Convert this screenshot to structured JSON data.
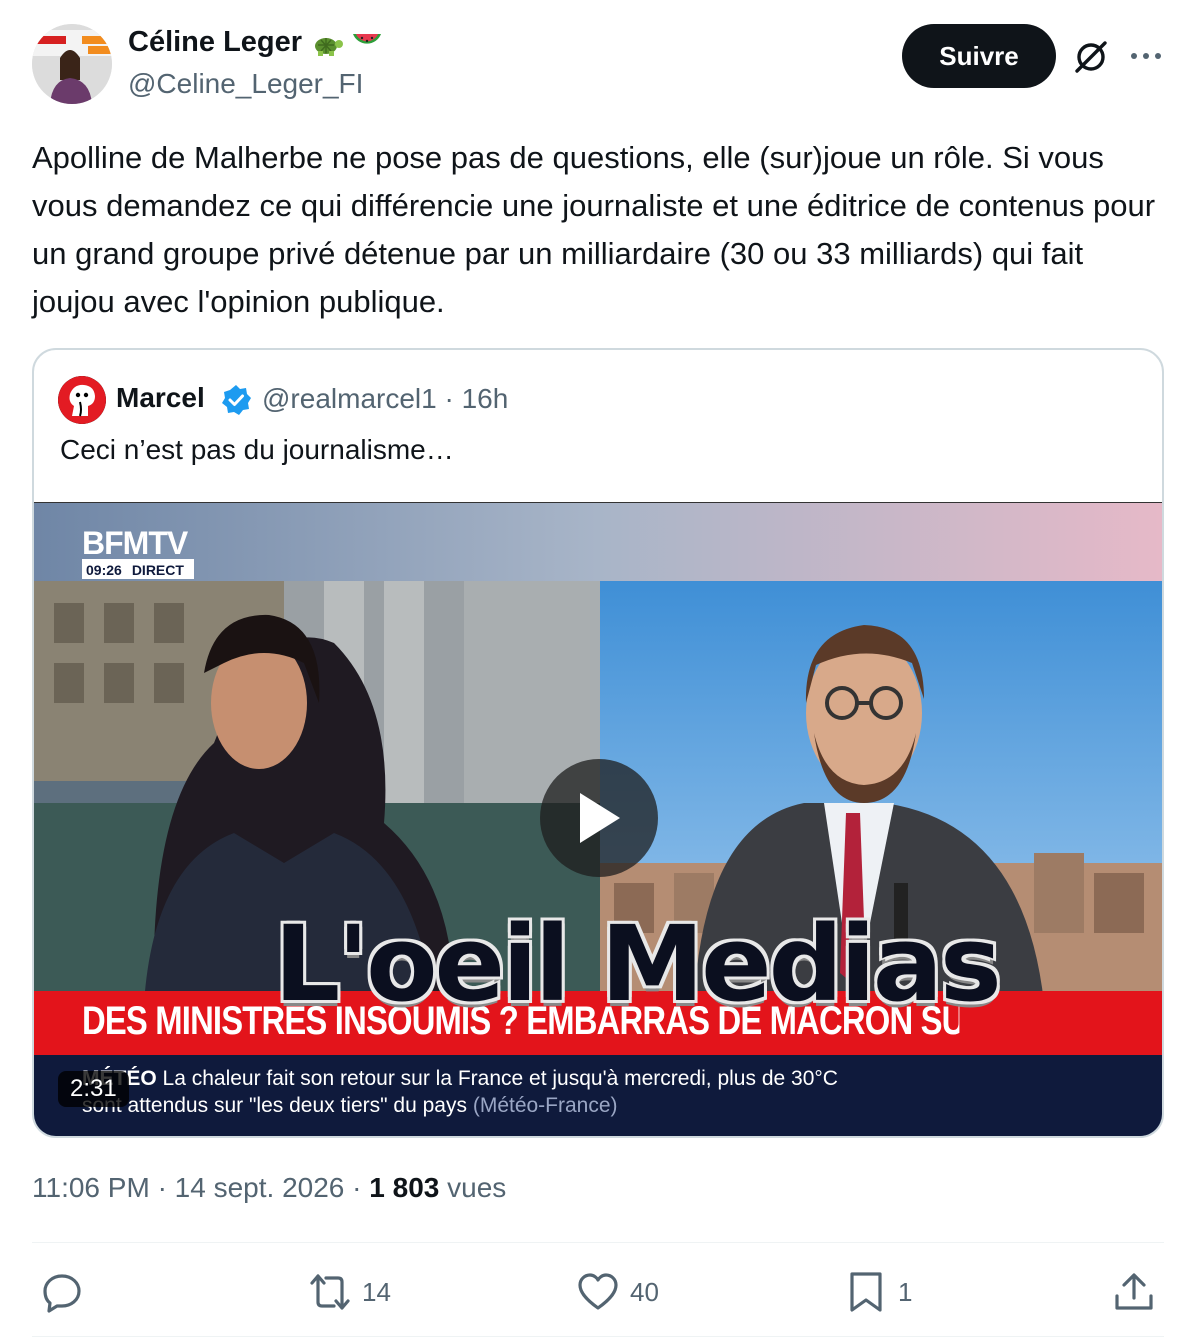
{
  "author": {
    "name": "Céline Leger",
    "emojis": "🐢 🍉",
    "handle": "@Celine_Leger_FI",
    "avatar_icon": "avatar-photo"
  },
  "header": {
    "follow_label": "Suivre",
    "grok_icon": "grok-icon",
    "more_icon": "more-icon"
  },
  "tweet": {
    "text": "Apolline de Malherbe ne pose pas de questions, elle (sur)joue un rôle. Si vous vous demandez ce qui différencie une journaliste et une éditrice de contenus pour un grand groupe privé détenue par un milliardaire (30 ou 33 milliards) qui fait joujou avec l'opinion publique."
  },
  "quote": {
    "name": "Marcel",
    "handle_time": "@realmarcel1 · 16h",
    "text": "Ceci n’est pas du journalisme…",
    "video": {
      "channel": "BFMTV",
      "clock": "09:26",
      "live": "DIRECT",
      "banner": "DES MINISTRES INSOUMIS ? EMBARRAS DE MACRON SUR BFMTV",
      "overlay": "L'oeil Medias",
      "ticker_tag": "MÉTÉO",
      "ticker_line1": "La chaleur fait son retour sur la France et jusqu'à mercredi, plus de 30°C",
      "ticker_line2_pre": "sont",
      "ticker_line2": "attendus sur \"les deux tiers\" du pays",
      "ticker_source": "(Météo-France)",
      "duration": "2:31"
    }
  },
  "meta": {
    "time": "11:06 PM",
    "date": "14 sept. 2026",
    "views_count": "1 803",
    "views_label": "vues"
  },
  "actions": {
    "replies": "",
    "reposts": "14",
    "likes": "40",
    "bookmarks": "1"
  },
  "colors": {
    "primary_text": "#0f1419",
    "secondary_text": "#536471",
    "border": "#cfd9de",
    "verified": "#1d9bf0",
    "banner_red": "#e3141b",
    "ticker_navy": "#0f1a3c"
  }
}
